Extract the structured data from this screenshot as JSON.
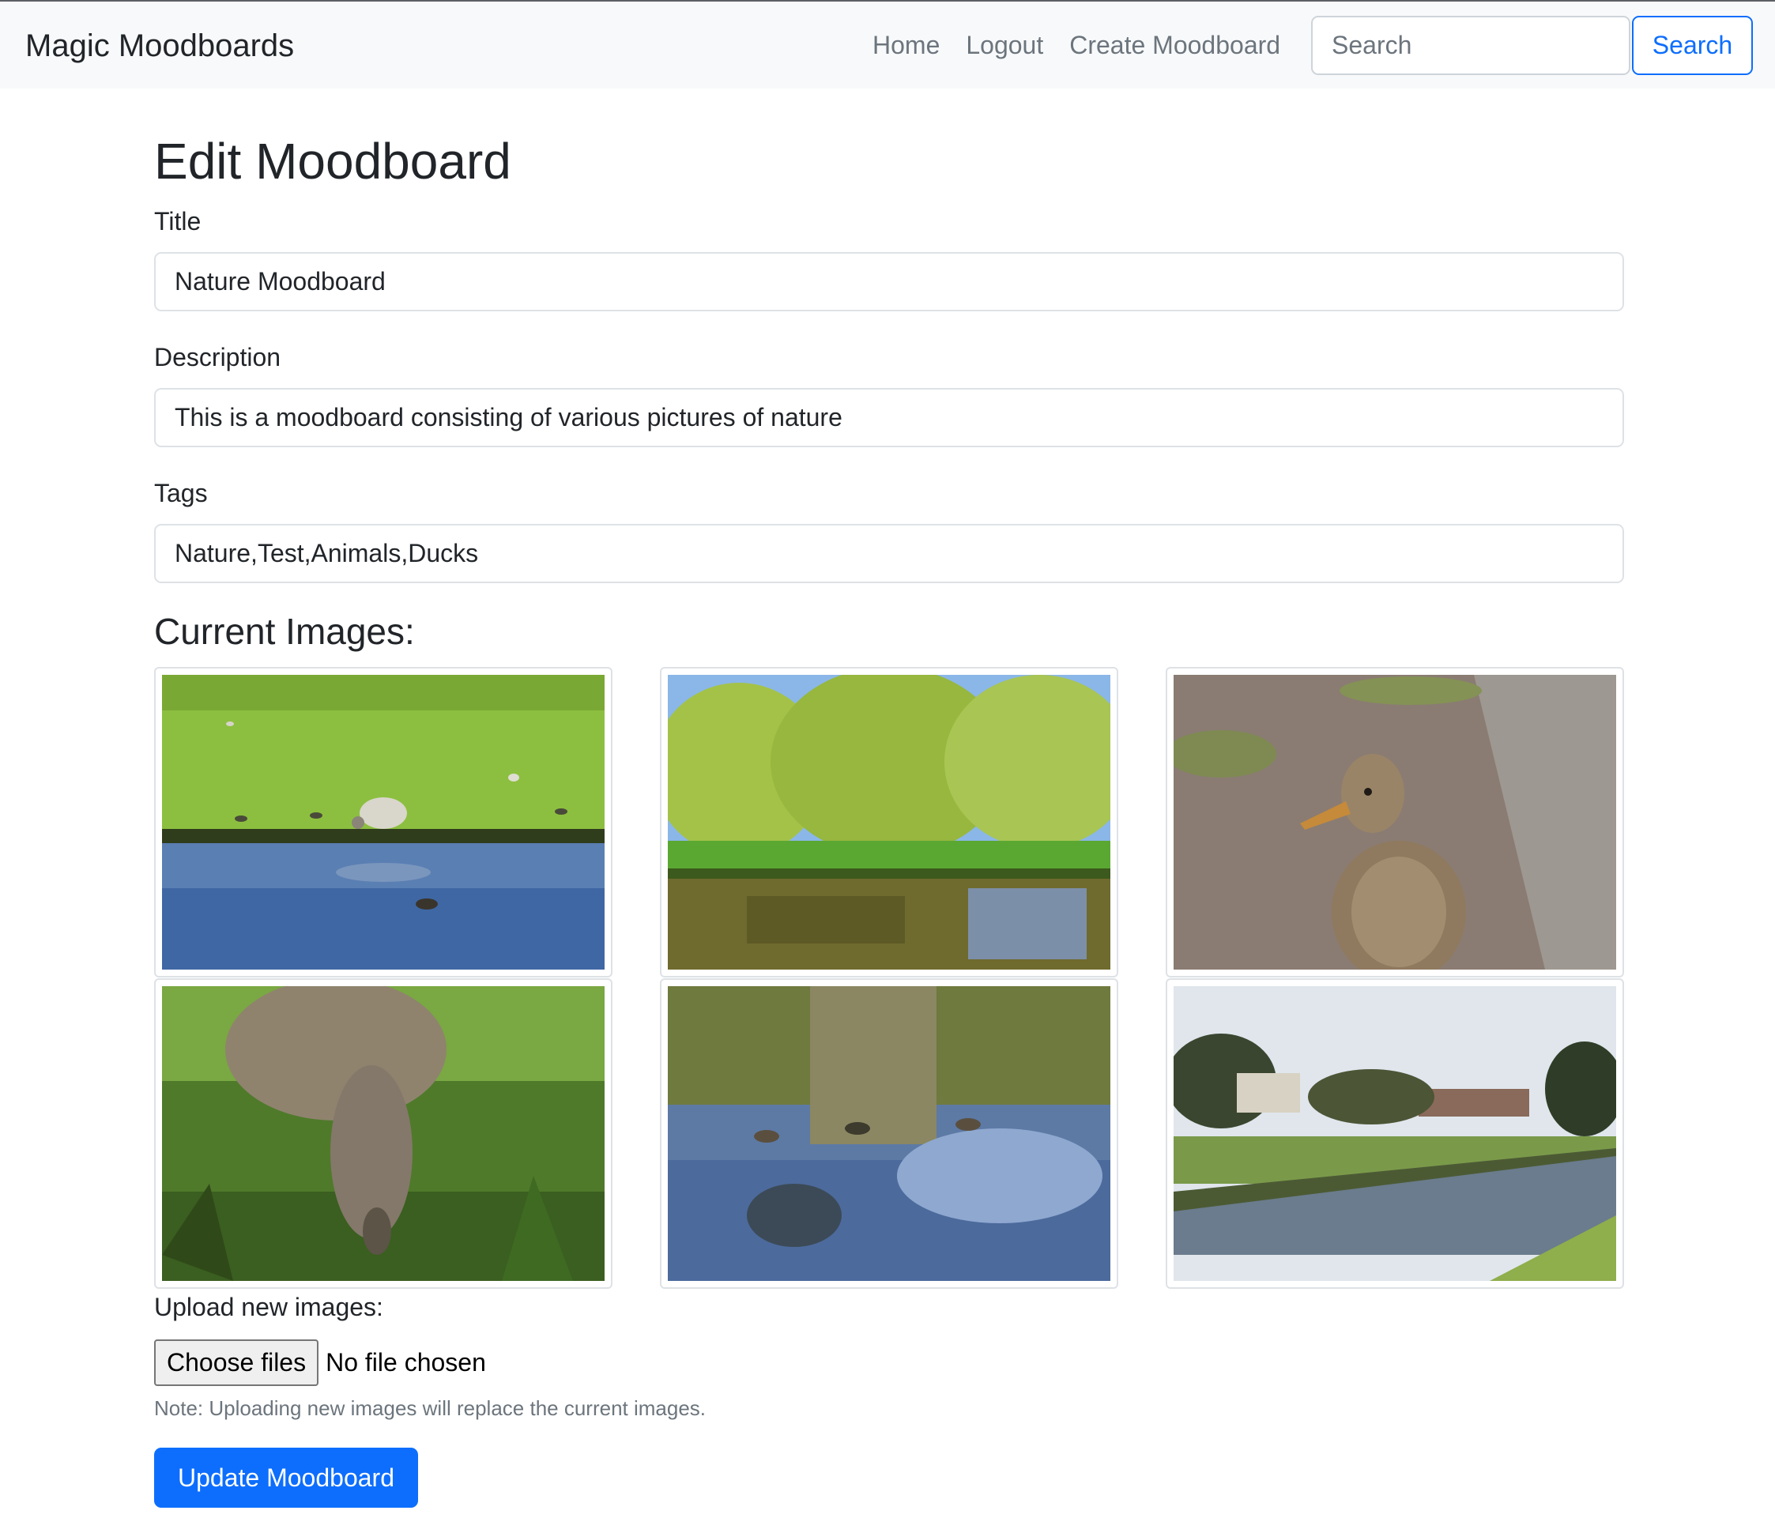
{
  "navbar": {
    "brand": "Magic Moodboards",
    "links": [
      "Home",
      "Logout",
      "Create Moodboard"
    ],
    "search": {
      "placeholder": "Search",
      "button_label": "Search"
    }
  },
  "form": {
    "heading": "Edit Moodboard",
    "title": {
      "label": "Title",
      "value": "Nature Moodboard"
    },
    "description": {
      "label": "Description",
      "value": "This is a moodboard consisting of various pictures of nature"
    },
    "tags": {
      "label": "Tags",
      "value": "Nature,Test,Animals,Ducks"
    }
  },
  "images": {
    "heading": "Current Images:",
    "items": [
      "sheep-by-river-photo",
      "willow-trees-river-photo",
      "duck-on-path-photo",
      "duck-in-grass-photo",
      "ducks-swimming-photo",
      "river-and-houses-photo"
    ]
  },
  "upload": {
    "label": "Upload new images:",
    "choose_button": "Choose files",
    "status": "No file chosen",
    "note": "Note: Uploading new images will replace the current images."
  },
  "submit_label": "Update Moodboard",
  "colors": {
    "primary": "#0d6efd",
    "navbar_bg": "#f8f9fa",
    "muted": "#6c757d"
  }
}
